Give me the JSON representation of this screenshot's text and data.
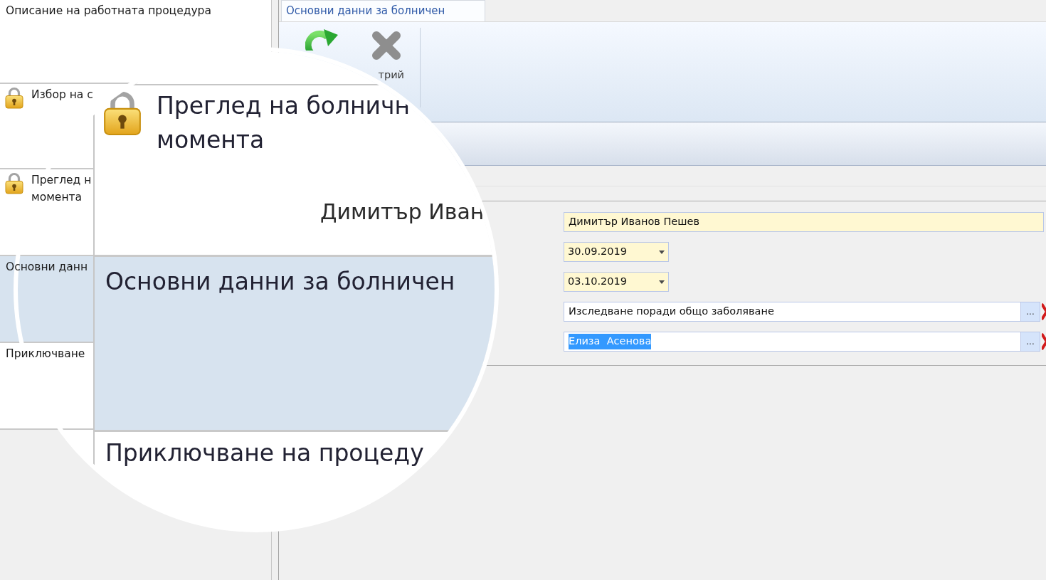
{
  "steps": [
    {
      "lines": [
        "Описание на работната процедура"
      ],
      "locked": false,
      "selected": false
    },
    {
      "lines": [
        "Избор на с"
      ],
      "locked": true,
      "selected": false
    },
    {
      "lines": [
        "Преглед н",
        "момента"
      ],
      "locked": true,
      "selected": false
    },
    {
      "lines": [
        "Основни данн"
      ],
      "locked": false,
      "selected": true
    },
    {
      "lines": [
        "Приключване"
      ],
      "locked": false,
      "selected": false
    }
  ],
  "tabs": [
    {
      "label": "Основни данни за болничен",
      "selected": true
    }
  ],
  "toolbar": {
    "buttons": [
      {
        "kind": "refresh"
      },
      {
        "kind": "delete",
        "label": "трий"
      }
    ]
  },
  "form": {
    "fields": [
      {
        "kind": "text",
        "value": "Димитър Иванов Пешев",
        "required": true
      },
      {
        "kind": "date",
        "value": "30.09.2019",
        "required": true
      },
      {
        "kind": "date",
        "value": "03.10.2019",
        "required": true
      },
      {
        "kind": "lookup",
        "value": "Изследване поради общо заболяване",
        "required": false,
        "text_selected": false,
        "button_label": "..."
      },
      {
        "kind": "lookup",
        "value": "Елиза  Асенова",
        "required": false,
        "text_selected": true,
        "button_label": "..."
      }
    ]
  },
  "magnifier": {
    "steps": [
      {
        "lines": [
          "Преглед на болничн",
          "момента"
        ],
        "locked": true,
        "selected": false,
        "detail": "Димитър Иван"
      },
      {
        "lines": [
          "Основни данни за болничен"
        ],
        "locked": false,
        "selected": true
      },
      {
        "lines": [
          "Приключване на процеду"
        ],
        "locked": false,
        "selected": false
      }
    ]
  }
}
